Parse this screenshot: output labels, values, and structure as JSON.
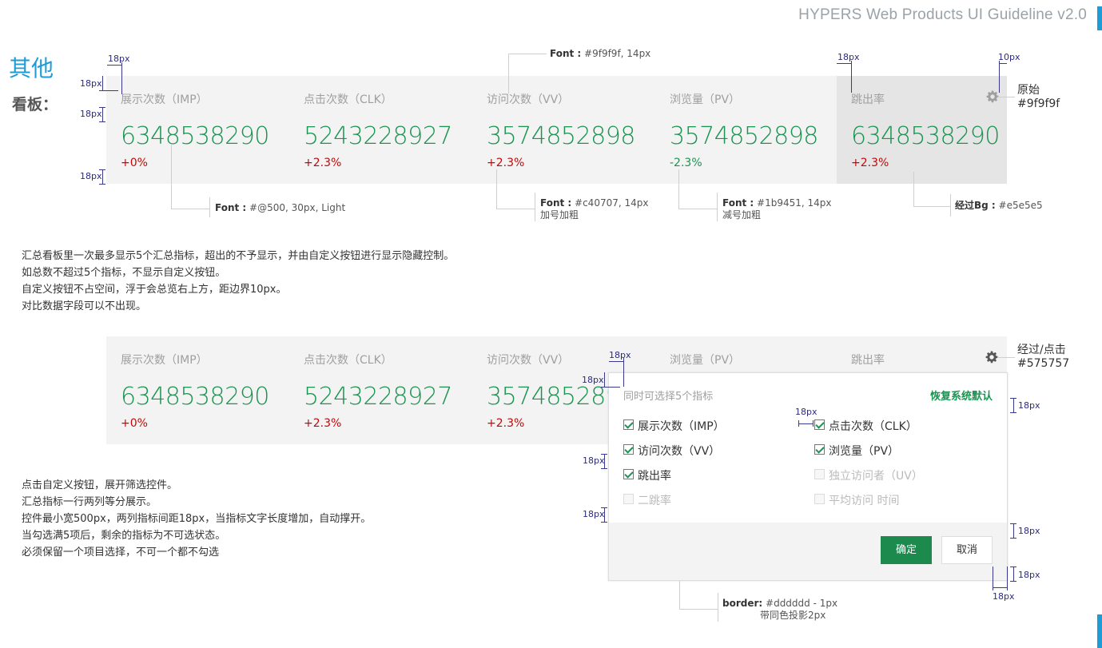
{
  "header": {
    "title": "HYPERS Web Products UI Guideline v2.0"
  },
  "section": {
    "title": "其他",
    "subtitle": "看板："
  },
  "board1": {
    "metrics": [
      {
        "label": "展示次数（IMP）",
        "value": "6348538290",
        "change": "+0%",
        "trend": "pos"
      },
      {
        "label": "点击次数（CLK）",
        "value": "5243228927",
        "change": "+2.3%",
        "trend": "pos"
      },
      {
        "label": "访问次数（VV）",
        "value": "3574852898",
        "change": "+2.3%",
        "trend": "pos"
      },
      {
        "label": "浏览量（PV）",
        "value": "3574852898",
        "change": "-2.3%",
        "trend": "neg"
      },
      {
        "label": "跳出率",
        "value": "6348538290",
        "change": "+2.3%",
        "trend": "pos"
      }
    ]
  },
  "annotations": {
    "dim_18": "18px",
    "dim_10": "10px",
    "font_label_b": "Font :",
    "font_label": " #9f9f9f, 14px",
    "font_value_b": "Font :",
    "font_value": " #@500, 30px, Light",
    "font_pos_b": "Font :",
    "font_pos": " #c40707, 14px",
    "font_pos_2": "加号加粗",
    "font_neg_b": "Font :",
    "font_neg": " #1b9451, 14px",
    "font_neg_2": "减号加粗",
    "hover_bg_b": "经过Bg :",
    "hover_bg": " #e5e5e5",
    "gear_orig_1": "原始",
    "gear_orig_2": "#9f9f9f",
    "gear_hover_1": "经过/点击",
    "gear_hover_2": "#575757",
    "border_b": "border:",
    "border_1": " #dddddd - 1px",
    "border_2": "带同色投影2px"
  },
  "desc1": [
    "汇总看板里一次最多显示5个汇总指标，超出的不予显示，并由自定义按钮进行显示隐藏控制。",
    "如总数不超过5个指标，不显示自定义按钮。",
    "自定义按钮不占空间，浮于会总览右上方，距边界10px。",
    "对比数据字段可以不出现。"
  ],
  "board2": {
    "metrics": [
      {
        "label": "展示次数（IMP）",
        "value": "6348538290",
        "change": "+0%"
      },
      {
        "label": "点击次数（CLK）",
        "value": "5243228927",
        "change": "+2.3%"
      },
      {
        "label": "访问次数（VV）",
        "value": "3574852898",
        "change": "+2.3%"
      },
      {
        "label": "浏览量（PV）"
      },
      {
        "label": "跳出率"
      }
    ]
  },
  "popup": {
    "heading": "同时可选择5个指标",
    "reset": "恢复系统默认",
    "options": [
      {
        "label": "展示次数（IMP）",
        "state": "checked"
      },
      {
        "label": "点击次数（CLK）",
        "state": "checked"
      },
      {
        "label": "访问次数（VV）",
        "state": "checked"
      },
      {
        "label": "浏览量（PV）",
        "state": "checked"
      },
      {
        "label": "跳出率",
        "state": "checked"
      },
      {
        "label": "独立访问者（UV）",
        "state": "disabled"
      },
      {
        "label": "二跳率",
        "state": "disabled"
      },
      {
        "label": "平均访问 时间",
        "state": "disabled"
      }
    ],
    "ok": "确定",
    "cancel": "取消"
  },
  "desc2": [
    "点击自定义按钮，展开筛选控件。",
    "汇总指标一行两列等分展示。",
    "控件最小宽500px，两列指标间距18px，当指标文字长度增加，自动撑开。",
    "当勾选满5项后，剩余的指标为不可选状态。",
    "必须保留一个项目选择，不可一个都不勾选"
  ],
  "colors": {
    "value": "#1b9451",
    "label": "#9f9f9f",
    "positive": "#c40707",
    "negative": "#1b9451",
    "hover_bg": "#e5e5e5",
    "gear_default": "#9f9f9f",
    "gear_hover": "#575757",
    "accent": "#1e9cd7"
  },
  "icons": {
    "gear": "gear-icon",
    "check": "checkbox-check-icon"
  }
}
